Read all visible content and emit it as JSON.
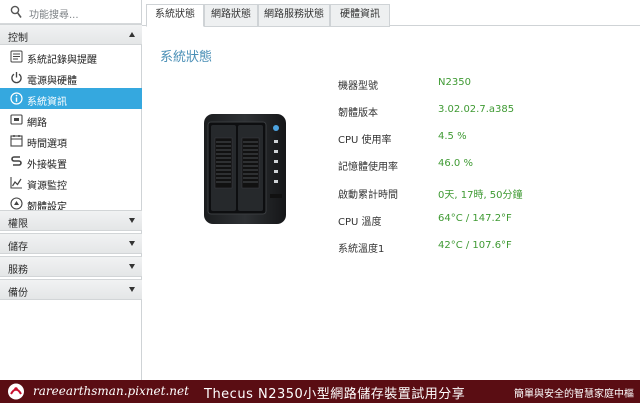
{
  "search": {
    "placeholder": "功能搜尋..."
  },
  "sidebar": {
    "sections": [
      {
        "label": "控制",
        "expanded": true
      },
      {
        "label": "權限",
        "expanded": false
      },
      {
        "label": "儲存",
        "expanded": false
      },
      {
        "label": "服務",
        "expanded": false
      },
      {
        "label": "備份",
        "expanded": false
      }
    ],
    "items": [
      {
        "label": "系統記錄與提醒",
        "icon": "notification-icon"
      },
      {
        "label": "電源與硬體",
        "icon": "power-icon"
      },
      {
        "label": "系統資訊",
        "icon": "info-icon",
        "active": true
      },
      {
        "label": "網路",
        "icon": "network-icon"
      },
      {
        "label": "時間選項",
        "icon": "clock-icon"
      },
      {
        "label": "外接裝置",
        "icon": "usb-icon"
      },
      {
        "label": "資源監控",
        "icon": "chart-icon"
      },
      {
        "label": "韌體設定",
        "icon": "firmware-icon"
      }
    ]
  },
  "tabs": [
    {
      "label": "系統狀態",
      "active": true
    },
    {
      "label": "網路狀態"
    },
    {
      "label": "網路服務狀態"
    },
    {
      "label": "硬體資訊"
    }
  ],
  "panel": {
    "title": "系統狀態",
    "rows": [
      {
        "label": "機器型號",
        "value": "N2350"
      },
      {
        "label": "韌體版本",
        "value": "3.02.02.7.a385"
      },
      {
        "label": "CPU 使用率",
        "value": "4.5 %"
      },
      {
        "label": "記憶體使用率",
        "value": "46.0 %"
      },
      {
        "label": "啟動累計時間",
        "value": "0天, 17時, 50分鐘"
      },
      {
        "label": "CPU 溫度",
        "value": "64°C / 147.2°F"
      },
      {
        "label": "系統溫度1",
        "value": "42°C / 107.6°F"
      }
    ]
  },
  "footer": {
    "site": "rareearthsman.pixnet.net",
    "title": "Thecus N2350小型網路儲存裝置試用分享",
    "slogan": "簡單與安全的智慧家庭中樞"
  },
  "colors": {
    "accent": "#35a8df",
    "value_green": "#3f9a33",
    "title_blue": "#4a8fb6",
    "footer_bg": "#5a0d13"
  }
}
